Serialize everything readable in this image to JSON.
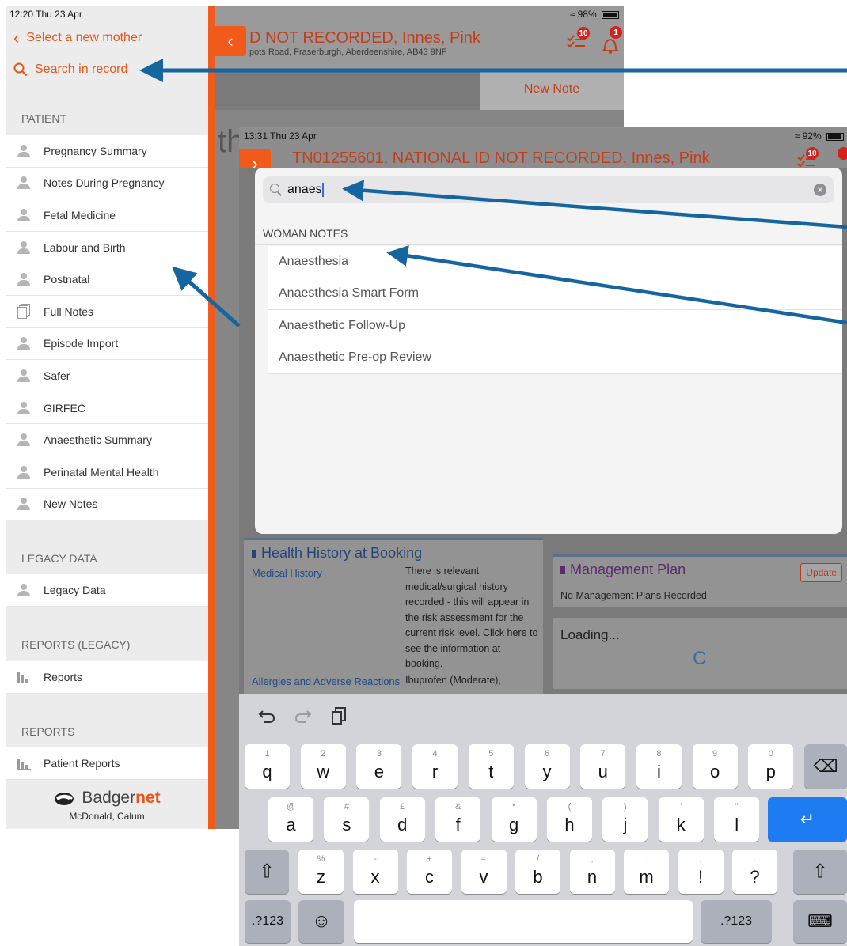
{
  "back": {
    "time": "12:20  Thu 23 Apr",
    "battery": "98%",
    "patient_title": "D NOT RECORDED, Innes, Pink",
    "address": "pots Road, Fraserburgh, Aberdeenshire, AB43 9NF",
    "new_note": "New Note",
    "task_badge": "10",
    "bell_badge": "1",
    "bg_text": "th",
    "sidebar": {
      "select_mother": "Select a new mother",
      "search_record": "Search in record",
      "patient_header": "PATIENT",
      "patient_items": [
        {
          "label": "Pregnancy Summary",
          "icon": "person"
        },
        {
          "label": "Notes During Pregnancy",
          "icon": "person"
        },
        {
          "label": "Fetal Medicine",
          "icon": "person"
        },
        {
          "label": "Labour and Birth",
          "icon": "person"
        },
        {
          "label": "Postnatal",
          "icon": "person"
        },
        {
          "label": "Full Notes",
          "icon": "documents"
        },
        {
          "label": "Episode Import",
          "icon": "person"
        },
        {
          "label": "Safer",
          "icon": "person"
        },
        {
          "label": "GIRFEC",
          "icon": "person"
        },
        {
          "label": "Anaesthetic Summary",
          "icon": "person"
        },
        {
          "label": "Perinatal Mental Health",
          "icon": "person"
        },
        {
          "label": "New Notes",
          "icon": "person"
        }
      ],
      "legacy_header": "LEGACY DATA",
      "legacy_item": "Legacy Data",
      "reports_legacy_header": "REPORTS (LEGACY)",
      "reports_item": "Reports",
      "reports_header": "REPORTS",
      "patient_reports_item": "Patient Reports",
      "brand_plain": "Badger",
      "brand_bold": "net",
      "user": "McDonald, Calum"
    }
  },
  "front": {
    "time": "13:31  Thu 23 Apr",
    "battery": "92%",
    "patient_title": "TN01255601, NATIONAL ID NOT RECORDED, Innes, Pink",
    "task_badge": "10",
    "search": {
      "value": "anaes",
      "results_header": "WOMAN NOTES",
      "results": [
        "Anaesthesia",
        "Anaesthesia Smart Form",
        "Anaesthetic Follow-Up",
        "Anaesthetic Pre-op Review"
      ]
    },
    "health_history": {
      "title": "Health History at Booking",
      "medical_history_label": "Medical History",
      "medical_history_text": "There is relevant medical/surgical history recorded - this will appear in the risk assessment for the current risk level. Click here to see the information at booking.",
      "allergies_label": "Allergies and Adverse Reactions",
      "allergies_text": "Ibuprofen (Moderate),"
    },
    "management": {
      "title": "Management Plan",
      "update_label": "Update",
      "text": "No Management Plans Recorded"
    },
    "loading": "Loading...",
    "keyboard": {
      "row1": [
        {
          "k": "q",
          "s": "1"
        },
        {
          "k": "w",
          "s": "2"
        },
        {
          "k": "e",
          "s": "3"
        },
        {
          "k": "r",
          "s": "4"
        },
        {
          "k": "t",
          "s": "5"
        },
        {
          "k": "y",
          "s": "6"
        },
        {
          "k": "u",
          "s": "7"
        },
        {
          "k": "i",
          "s": "8"
        },
        {
          "k": "o",
          "s": "9"
        },
        {
          "k": "p",
          "s": "0"
        }
      ],
      "row2": [
        {
          "k": "a",
          "s": "@"
        },
        {
          "k": "s",
          "s": "#"
        },
        {
          "k": "d",
          "s": "£"
        },
        {
          "k": "f",
          "s": "&"
        },
        {
          "k": "g",
          "s": "*"
        },
        {
          "k": "h",
          "s": "("
        },
        {
          "k": "j",
          "s": ")"
        },
        {
          "k": "k",
          "s": "'"
        },
        {
          "k": "l",
          "s": "\""
        }
      ],
      "row3": [
        {
          "k": "z",
          "s": "%"
        },
        {
          "k": "x",
          "s": "-"
        },
        {
          "k": "c",
          "s": "+"
        },
        {
          "k": "v",
          "s": "="
        },
        {
          "k": "b",
          "s": "/"
        },
        {
          "k": "n",
          "s": ";"
        },
        {
          "k": "m",
          "s": ":"
        },
        {
          "k": "!",
          "s": ","
        },
        {
          "k": "?",
          "s": "."
        }
      ],
      "numbers_label": ".?123",
      "numbers_label_right": ".?123"
    }
  },
  "colors": {
    "accent": "#f25a1c",
    "title_red": "#c43d1b",
    "arrow_blue": "#1565a0",
    "key_return": "#1e7cf2"
  }
}
